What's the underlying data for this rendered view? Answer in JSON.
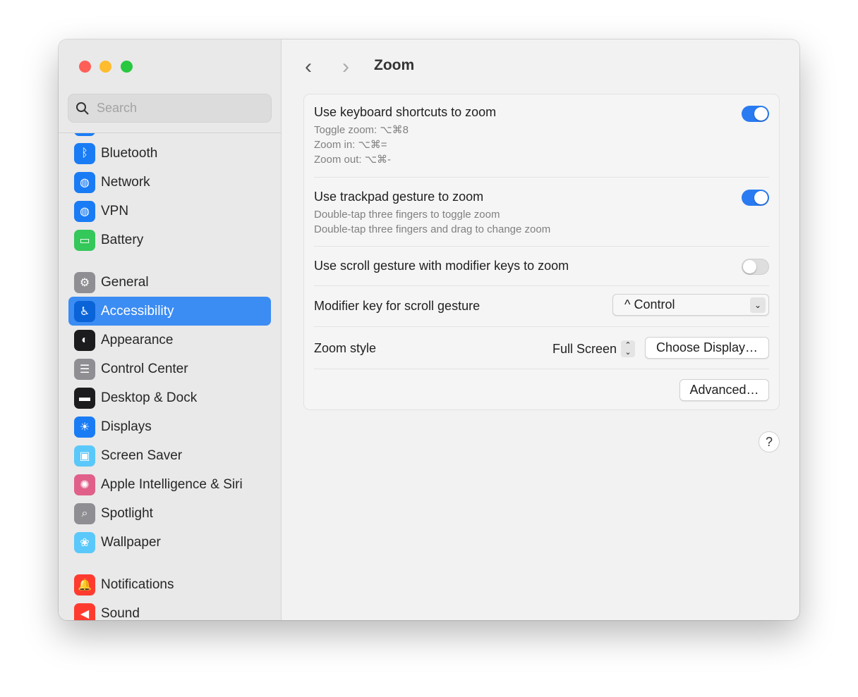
{
  "window": {
    "title": "Zoom"
  },
  "sidebar": {
    "search_placeholder": "Search",
    "items": [
      {
        "label": "Bluetooth",
        "icon": "bluetooth-icon",
        "color": "#1a7cf5"
      },
      {
        "label": "Network",
        "icon": "globe-icon",
        "color": "#1a7cf5"
      },
      {
        "label": "VPN",
        "icon": "vpn-globe-icon",
        "color": "#1a7cf5"
      },
      {
        "label": "Battery",
        "icon": "battery-icon",
        "color": "#34c759"
      },
      {
        "label": "General",
        "icon": "gear-icon",
        "color": "#8e8e93"
      },
      {
        "label": "Accessibility",
        "icon": "accessibility-icon",
        "color": "#0a64d8",
        "selected": true
      },
      {
        "label": "Appearance",
        "icon": "appearance-icon",
        "color": "#1c1c1e"
      },
      {
        "label": "Control Center",
        "icon": "control-center-icon",
        "color": "#8e8e93"
      },
      {
        "label": "Desktop & Dock",
        "icon": "dock-icon",
        "color": "#1c1c1e"
      },
      {
        "label": "Displays",
        "icon": "sun-icon",
        "color": "#1a7cf5"
      },
      {
        "label": "Screen Saver",
        "icon": "screen-saver-icon",
        "color": "#5ac8fa"
      },
      {
        "label": "Apple Intelligence & Siri",
        "icon": "siri-icon",
        "color": "#e0608a"
      },
      {
        "label": "Spotlight",
        "icon": "magnifier-icon",
        "color": "#8e8e93"
      },
      {
        "label": "Wallpaper",
        "icon": "flower-icon",
        "color": "#5ac8fa"
      },
      {
        "label": "Notifications",
        "icon": "bell-icon",
        "color": "#ff3b30"
      },
      {
        "label": "Sound",
        "icon": "speaker-icon",
        "color": "#ff3b30"
      }
    ]
  },
  "settings": {
    "keyboard": {
      "label": "Use keyboard shortcuts to zoom",
      "lines": [
        "Toggle zoom: ⌥⌘8",
        "Zoom in: ⌥⌘=",
        "Zoom out: ⌥⌘-"
      ],
      "enabled": true
    },
    "trackpad": {
      "label": "Use trackpad gesture to zoom",
      "lines": [
        "Double-tap three fingers to toggle zoom",
        "Double-tap three fingers and drag to change zoom"
      ],
      "enabled": true
    },
    "scroll": {
      "label": "Use scroll gesture with modifier keys to zoom",
      "enabled": false
    },
    "modifier": {
      "label": "Modifier key for scroll gesture",
      "value": "^ Control"
    },
    "style": {
      "label": "Zoom style",
      "value": "Full Screen",
      "choose_display": "Choose Display…"
    },
    "advanced": "Advanced…",
    "help": "?"
  }
}
